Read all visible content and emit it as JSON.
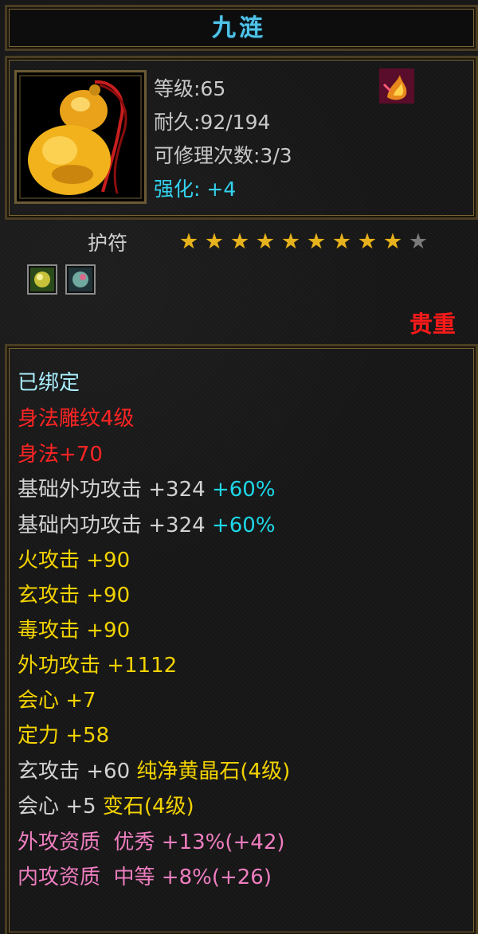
{
  "item": {
    "name": "九涟",
    "level_text": "等级:65",
    "durability_text": "耐久:92/194",
    "repair_text": "可修理次数:3/3",
    "enhance_label": "强化:",
    "enhance_value": "+4",
    "type": "护符",
    "stars_filled": 9,
    "stars_total": 10,
    "rarity": "贵重"
  },
  "icons": {
    "item_icon": "gourd-amulet-icon",
    "skill_icon": "flame-emblem-icon",
    "gem_slot_1": "green-gem-icon",
    "gem_slot_2": "teal-gem-icon"
  },
  "attributes": {
    "bound": "已绑定",
    "carving": "身法雕纹4级",
    "agility": "身法+70",
    "ext_base": {
      "label": "基础外功攻击 +324",
      "pct": "+60%"
    },
    "int_base": {
      "label": "基础内功攻击 +324",
      "pct": "+60%"
    },
    "fire": "火攻击 +90",
    "mystic": "玄攻击 +90",
    "poison": "毒攻击 +90",
    "ext_attack": "外功攻击 +1112",
    "crit": "会心 +7",
    "focus": "定力 +58",
    "gem_line_1": {
      "stat": "玄攻击 +60",
      "gem": "纯净黄晶石(4级)"
    },
    "gem_line_2": {
      "stat": "会心 +5",
      "gem": "变石(4级)"
    },
    "quality_1": "外攻资质  优秀 +13%(+42)",
    "quality_2": "内攻资质  中等 +8%(+26)"
  }
}
